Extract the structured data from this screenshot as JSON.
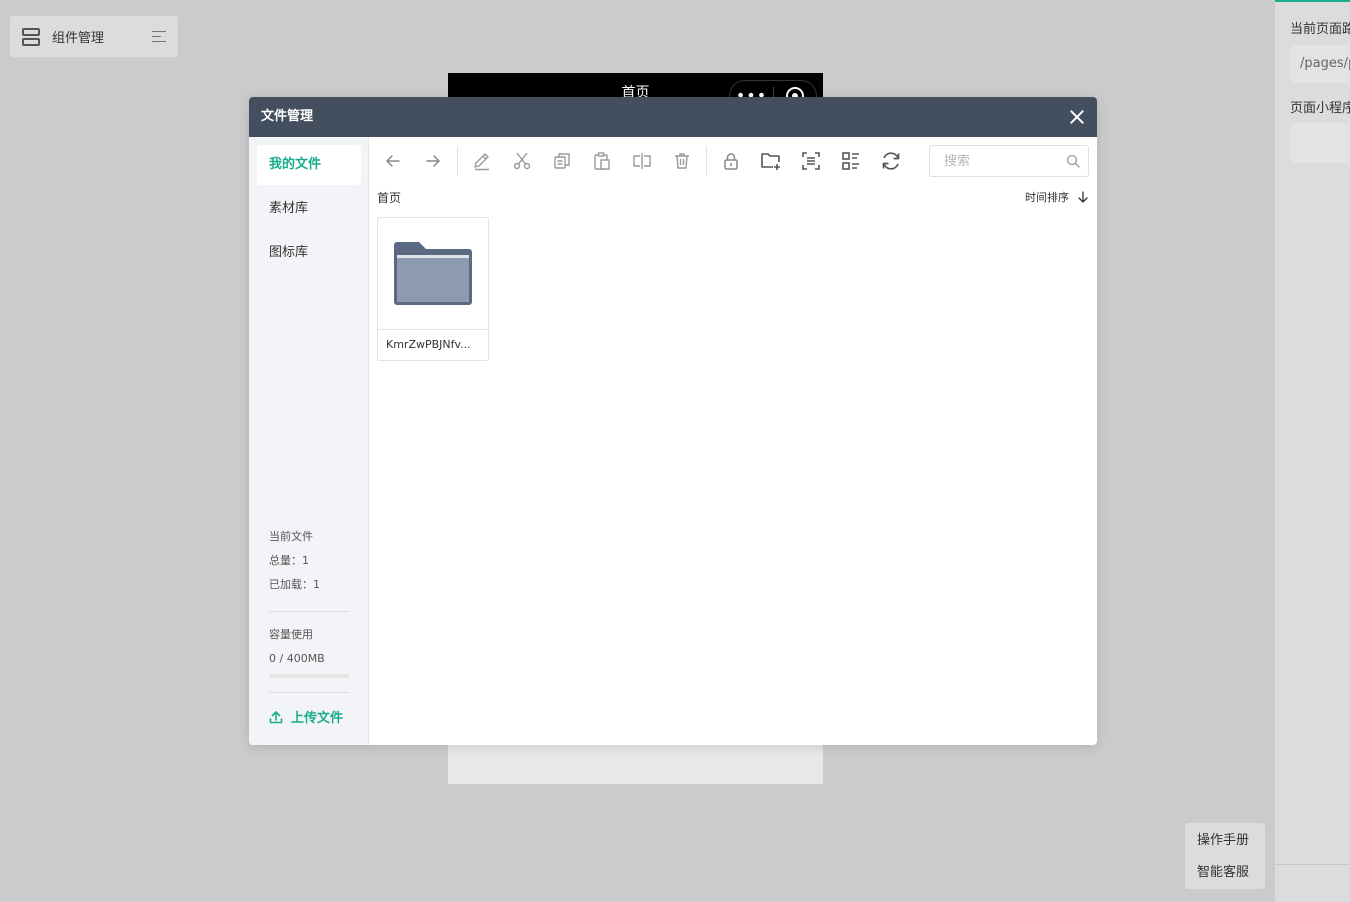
{
  "background": {
    "component_manager_label": "组件管理",
    "phone_title": "首页",
    "phone_capsule_dots": "•••",
    "right_panel": {
      "path_label": "当前页面路",
      "path_value": "/pages/p",
      "miniprogram_label": "页面小程序"
    },
    "help": {
      "manual": "操作手册",
      "service": "智能客服"
    }
  },
  "modal": {
    "title": "文件管理",
    "sidebar": {
      "items": [
        {
          "label": "我的文件",
          "active": true
        },
        {
          "label": "素材库",
          "active": false
        },
        {
          "label": "图标库",
          "active": false
        }
      ],
      "current_files_label": "当前文件",
      "total_label": "总量：1",
      "loaded_label": "已加载：1",
      "capacity_label": "容量使用",
      "capacity_value": "0 / 400MB",
      "capacity_fraction": 0,
      "upload_label": "上传文件"
    },
    "toolbar": {
      "icons": [
        "back-arrow-icon",
        "forward-arrow-icon",
        "rename-pencil-icon",
        "cut-scissors-icon",
        "copy-icon",
        "paste-icon",
        "move-icon",
        "delete-trash-icon",
        "lock-icon",
        "new-folder-icon",
        "select-all-icon",
        "list-view-icon",
        "refresh-icon"
      ]
    },
    "search": {
      "placeholder": "搜索"
    },
    "breadcrumb": "首页",
    "sort_label": "时间排序",
    "files": [
      {
        "name": "KmrZwPBJNfv...",
        "type": "folder"
      }
    ]
  },
  "colors": {
    "accent": "#1aad8d",
    "header": "#434e5e",
    "folder_front": "#8e9ab0",
    "folder_back": "#5b6a83"
  }
}
